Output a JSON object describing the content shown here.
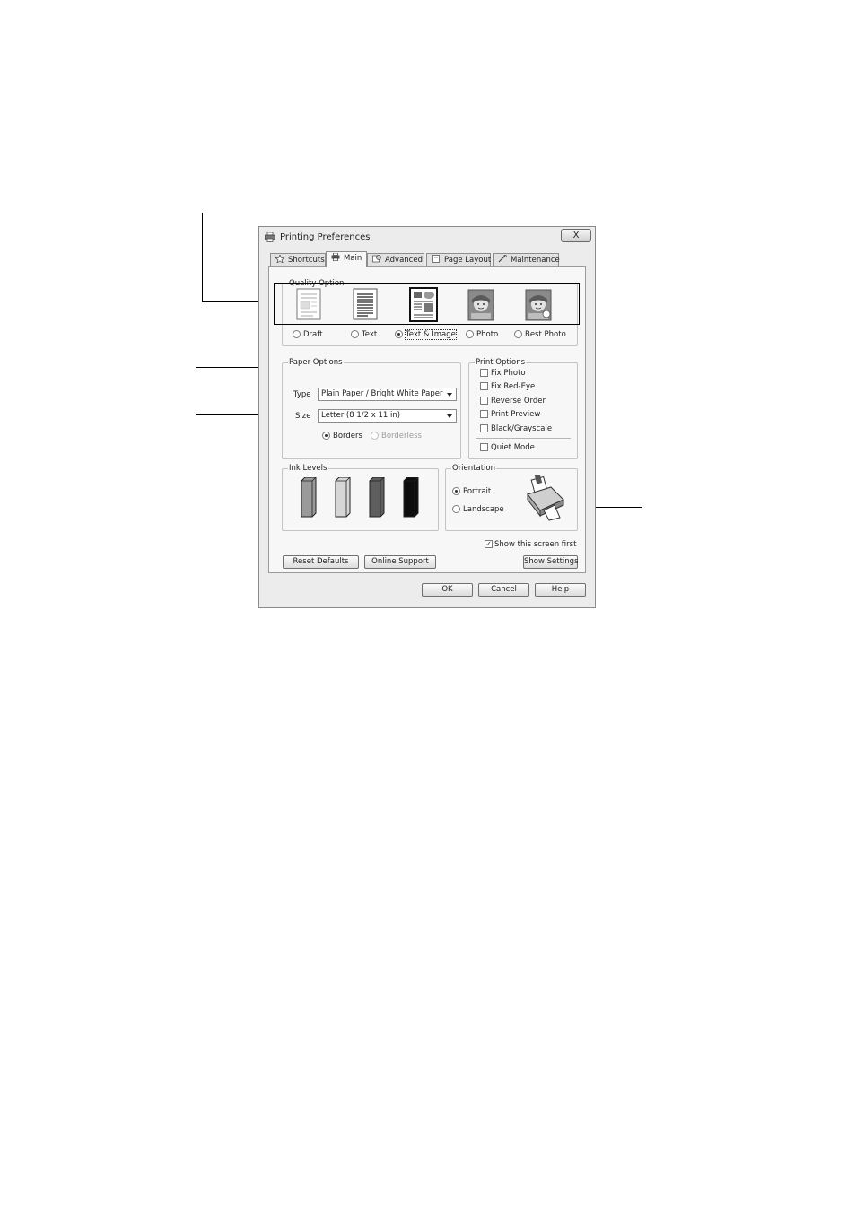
{
  "window": {
    "title": "Printing Preferences",
    "close_label": "X"
  },
  "tabs": [
    {
      "label": "Shortcuts",
      "icon": "shortcuts-star-icon"
    },
    {
      "label": "Main",
      "icon": "printer-icon",
      "active": true
    },
    {
      "label": "Advanced",
      "icon": "advanced-icon"
    },
    {
      "label": "Page Layout",
      "icon": "page-layout-icon"
    },
    {
      "label": "Maintenance",
      "icon": "maintenance-icon"
    }
  ],
  "quality": {
    "label": "Quality Option",
    "options": [
      "Draft",
      "Text",
      "Text & Image",
      "Photo",
      "Best Photo"
    ],
    "selected": "Text & Image"
  },
  "paper": {
    "label": "Paper Options",
    "type_label": "Type",
    "type_value": "Plain Paper / Bright White Paper",
    "size_label": "Size",
    "size_value": "Letter (8 1/2 x 11 in)",
    "borders_label": "Borders",
    "borderless_label": "Borderless"
  },
  "print_options": {
    "label": "Print Options",
    "items": [
      "Fix Photo",
      "Fix Red-Eye",
      "Reverse Order",
      "Print Preview",
      "Black/Grayscale"
    ],
    "quiet_mode": "Quiet Mode"
  },
  "ink": {
    "label": "Ink Levels",
    "colors": [
      "#9a9a9a",
      "#d6d6d6",
      "#5e5e5e",
      "#0d0d0d"
    ]
  },
  "orientation": {
    "label": "Orientation",
    "portrait": "Portrait",
    "landscape": "Landscape",
    "selected": "Portrait"
  },
  "show_screen_first": "Show this screen first",
  "buttons": {
    "reset_defaults": "Reset Defaults",
    "online_support": "Online Support",
    "show_settings": "Show Settings",
    "ok": "OK",
    "cancel": "Cancel",
    "help": "Help"
  }
}
